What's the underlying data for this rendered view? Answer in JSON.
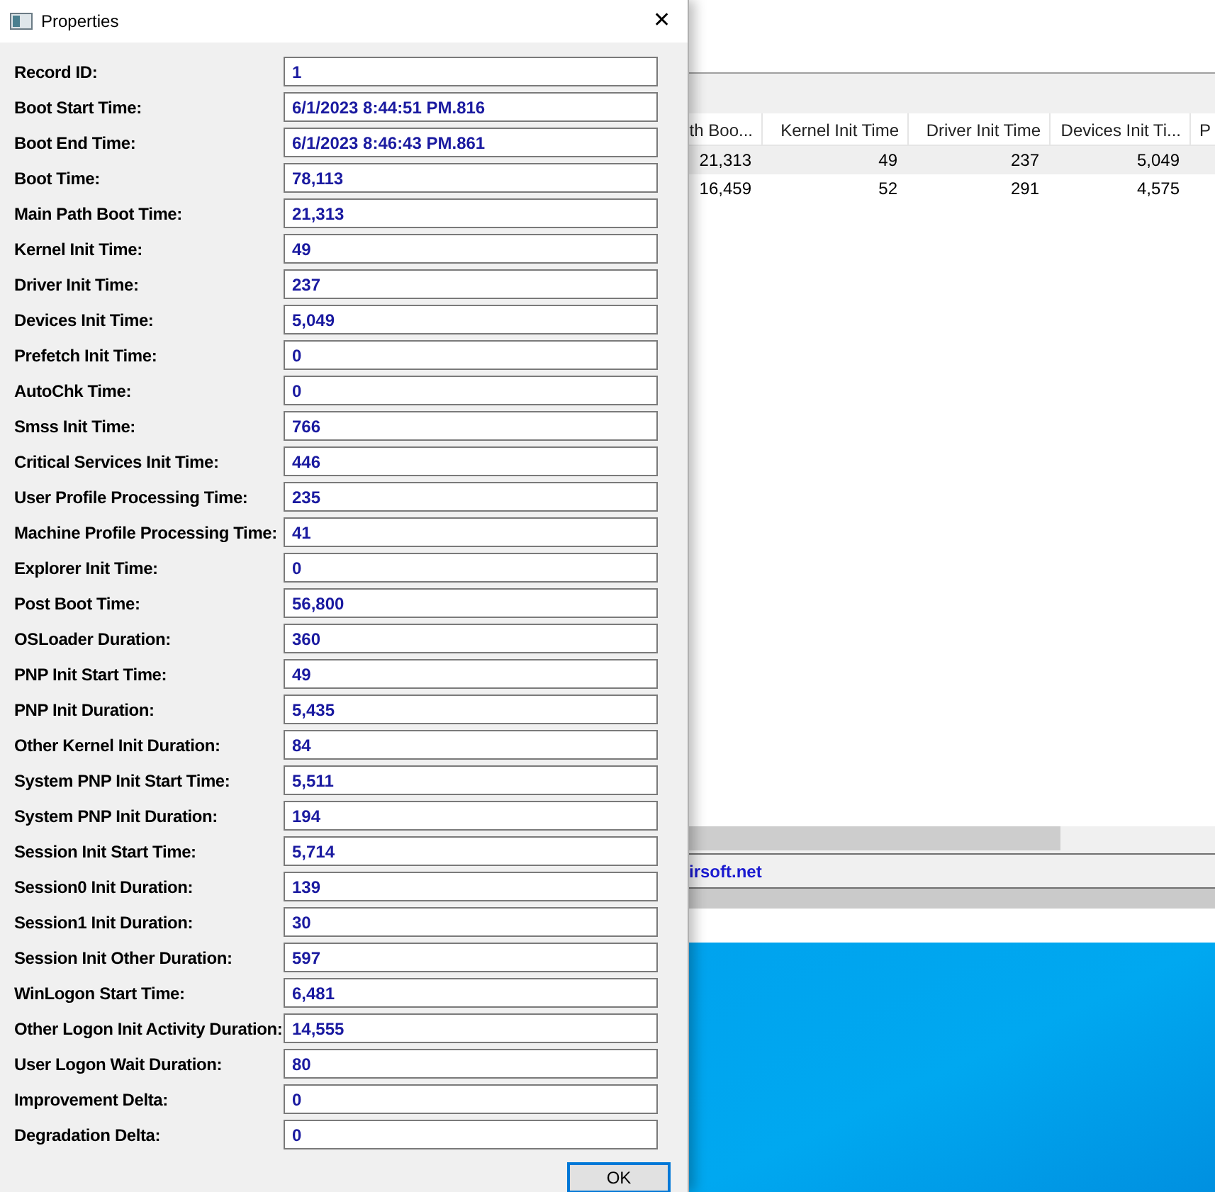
{
  "dialog": {
    "title": "Properties",
    "close": "✕",
    "fields": [
      {
        "label": "Record ID:",
        "value": "1"
      },
      {
        "label": "Boot Start Time:",
        "value": "6/1/2023 8:44:51 PM.816"
      },
      {
        "label": "Boot End Time:",
        "value": "6/1/2023 8:46:43 PM.861"
      },
      {
        "label": "Boot Time:",
        "value": "78,113"
      },
      {
        "label": "Main Path Boot Time:",
        "value": "21,313"
      },
      {
        "label": "Kernel Init Time:",
        "value": "49"
      },
      {
        "label": "Driver Init Time:",
        "value": "237"
      },
      {
        "label": "Devices Init Time:",
        "value": "5,049"
      },
      {
        "label": "Prefetch Init Time:",
        "value": "0"
      },
      {
        "label": "AutoChk Time:",
        "value": "0"
      },
      {
        "label": "Smss Init Time:",
        "value": "766"
      },
      {
        "label": "Critical Services Init Time:",
        "value": "446"
      },
      {
        "label": "User Profile Processing Time:",
        "value": "235"
      },
      {
        "label": "Machine Profile Processing Time:",
        "value": "41"
      },
      {
        "label": "Explorer Init Time:",
        "value": "0"
      },
      {
        "label": "Post Boot Time:",
        "value": "56,800"
      },
      {
        "label": "OSLoader Duration:",
        "value": "360"
      },
      {
        "label": "PNP Init Start Time:",
        "value": "49"
      },
      {
        "label": "PNP Init Duration:",
        "value": "5,435"
      },
      {
        "label": "Other Kernel Init Duration:",
        "value": "84"
      },
      {
        "label": "System PNP Init Start Time:",
        "value": "5,511"
      },
      {
        "label": "System PNP Init Duration:",
        "value": "194"
      },
      {
        "label": "Session Init Start Time:",
        "value": "5,714"
      },
      {
        "label": "Session0 Init Duration:",
        "value": "139"
      },
      {
        "label": "Session1 Init Duration:",
        "value": "30"
      },
      {
        "label": "Session Init Other Duration:",
        "value": "597"
      },
      {
        "label": "WinLogon Start Time:",
        "value": "6,481"
      },
      {
        "label": "Other Logon Init Activity Duration:",
        "value": "14,555"
      },
      {
        "label": "User Logon Wait Duration:",
        "value": "80"
      },
      {
        "label": "Improvement Delta:",
        "value": "0"
      },
      {
        "label": "Degradation Delta:",
        "value": "0"
      }
    ],
    "ok_button": "OK"
  },
  "background_window": {
    "table": {
      "columns": [
        "th Boo...",
        "Kernel Init Time",
        "Driver Init Time",
        "Devices Init Ti...",
        "P"
      ],
      "rows": [
        {
          "selected": true,
          "cells": [
            "21,313",
            "49",
            "237",
            "5,049"
          ]
        },
        {
          "selected": false,
          "cells": [
            "16,459",
            "52",
            "291",
            "4,575"
          ]
        }
      ]
    },
    "status_link": "irsoft.net"
  }
}
